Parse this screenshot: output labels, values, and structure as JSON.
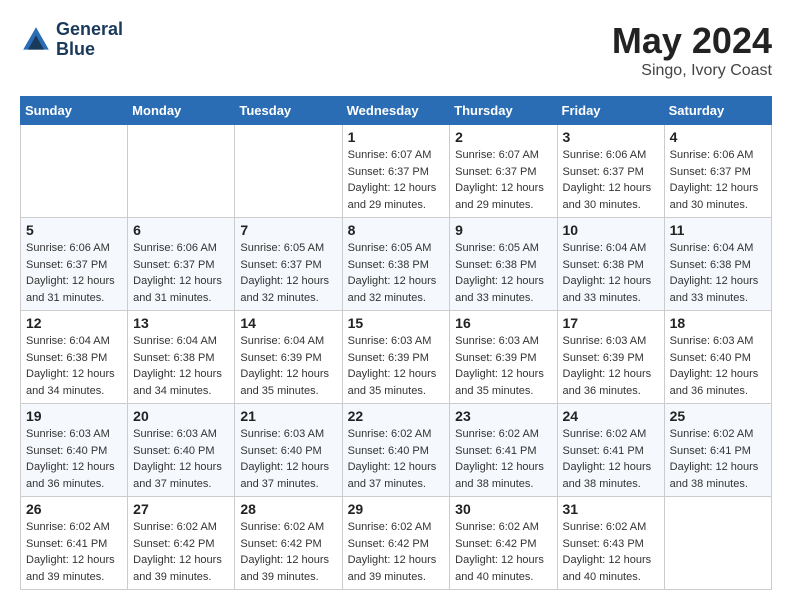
{
  "header": {
    "logo_line1": "General",
    "logo_line2": "Blue",
    "month_year": "May 2024",
    "location": "Singo, Ivory Coast"
  },
  "weekdays": [
    "Sunday",
    "Monday",
    "Tuesday",
    "Wednesday",
    "Thursday",
    "Friday",
    "Saturday"
  ],
  "weeks": [
    [
      {
        "day": "",
        "sunrise": "",
        "sunset": "",
        "daylight": ""
      },
      {
        "day": "",
        "sunrise": "",
        "sunset": "",
        "daylight": ""
      },
      {
        "day": "",
        "sunrise": "",
        "sunset": "",
        "daylight": ""
      },
      {
        "day": "1",
        "sunrise": "Sunrise: 6:07 AM",
        "sunset": "Sunset: 6:37 PM",
        "daylight": "Daylight: 12 hours and 29 minutes."
      },
      {
        "day": "2",
        "sunrise": "Sunrise: 6:07 AM",
        "sunset": "Sunset: 6:37 PM",
        "daylight": "Daylight: 12 hours and 29 minutes."
      },
      {
        "day": "3",
        "sunrise": "Sunrise: 6:06 AM",
        "sunset": "Sunset: 6:37 PM",
        "daylight": "Daylight: 12 hours and 30 minutes."
      },
      {
        "day": "4",
        "sunrise": "Sunrise: 6:06 AM",
        "sunset": "Sunset: 6:37 PM",
        "daylight": "Daylight: 12 hours and 30 minutes."
      }
    ],
    [
      {
        "day": "5",
        "sunrise": "Sunrise: 6:06 AM",
        "sunset": "Sunset: 6:37 PM",
        "daylight": "Daylight: 12 hours and 31 minutes."
      },
      {
        "day": "6",
        "sunrise": "Sunrise: 6:06 AM",
        "sunset": "Sunset: 6:37 PM",
        "daylight": "Daylight: 12 hours and 31 minutes."
      },
      {
        "day": "7",
        "sunrise": "Sunrise: 6:05 AM",
        "sunset": "Sunset: 6:37 PM",
        "daylight": "Daylight: 12 hours and 32 minutes."
      },
      {
        "day": "8",
        "sunrise": "Sunrise: 6:05 AM",
        "sunset": "Sunset: 6:38 PM",
        "daylight": "Daylight: 12 hours and 32 minutes."
      },
      {
        "day": "9",
        "sunrise": "Sunrise: 6:05 AM",
        "sunset": "Sunset: 6:38 PM",
        "daylight": "Daylight: 12 hours and 33 minutes."
      },
      {
        "day": "10",
        "sunrise": "Sunrise: 6:04 AM",
        "sunset": "Sunset: 6:38 PM",
        "daylight": "Daylight: 12 hours and 33 minutes."
      },
      {
        "day": "11",
        "sunrise": "Sunrise: 6:04 AM",
        "sunset": "Sunset: 6:38 PM",
        "daylight": "Daylight: 12 hours and 33 minutes."
      }
    ],
    [
      {
        "day": "12",
        "sunrise": "Sunrise: 6:04 AM",
        "sunset": "Sunset: 6:38 PM",
        "daylight": "Daylight: 12 hours and 34 minutes."
      },
      {
        "day": "13",
        "sunrise": "Sunrise: 6:04 AM",
        "sunset": "Sunset: 6:38 PM",
        "daylight": "Daylight: 12 hours and 34 minutes."
      },
      {
        "day": "14",
        "sunrise": "Sunrise: 6:04 AM",
        "sunset": "Sunset: 6:39 PM",
        "daylight": "Daylight: 12 hours and 35 minutes."
      },
      {
        "day": "15",
        "sunrise": "Sunrise: 6:03 AM",
        "sunset": "Sunset: 6:39 PM",
        "daylight": "Daylight: 12 hours and 35 minutes."
      },
      {
        "day": "16",
        "sunrise": "Sunrise: 6:03 AM",
        "sunset": "Sunset: 6:39 PM",
        "daylight": "Daylight: 12 hours and 35 minutes."
      },
      {
        "day": "17",
        "sunrise": "Sunrise: 6:03 AM",
        "sunset": "Sunset: 6:39 PM",
        "daylight": "Daylight: 12 hours and 36 minutes."
      },
      {
        "day": "18",
        "sunrise": "Sunrise: 6:03 AM",
        "sunset": "Sunset: 6:40 PM",
        "daylight": "Daylight: 12 hours and 36 minutes."
      }
    ],
    [
      {
        "day": "19",
        "sunrise": "Sunrise: 6:03 AM",
        "sunset": "Sunset: 6:40 PM",
        "daylight": "Daylight: 12 hours and 36 minutes."
      },
      {
        "day": "20",
        "sunrise": "Sunrise: 6:03 AM",
        "sunset": "Sunset: 6:40 PM",
        "daylight": "Daylight: 12 hours and 37 minutes."
      },
      {
        "day": "21",
        "sunrise": "Sunrise: 6:03 AM",
        "sunset": "Sunset: 6:40 PM",
        "daylight": "Daylight: 12 hours and 37 minutes."
      },
      {
        "day": "22",
        "sunrise": "Sunrise: 6:02 AM",
        "sunset": "Sunset: 6:40 PM",
        "daylight": "Daylight: 12 hours and 37 minutes."
      },
      {
        "day": "23",
        "sunrise": "Sunrise: 6:02 AM",
        "sunset": "Sunset: 6:41 PM",
        "daylight": "Daylight: 12 hours and 38 minutes."
      },
      {
        "day": "24",
        "sunrise": "Sunrise: 6:02 AM",
        "sunset": "Sunset: 6:41 PM",
        "daylight": "Daylight: 12 hours and 38 minutes."
      },
      {
        "day": "25",
        "sunrise": "Sunrise: 6:02 AM",
        "sunset": "Sunset: 6:41 PM",
        "daylight": "Daylight: 12 hours and 38 minutes."
      }
    ],
    [
      {
        "day": "26",
        "sunrise": "Sunrise: 6:02 AM",
        "sunset": "Sunset: 6:41 PM",
        "daylight": "Daylight: 12 hours and 39 minutes."
      },
      {
        "day": "27",
        "sunrise": "Sunrise: 6:02 AM",
        "sunset": "Sunset: 6:42 PM",
        "daylight": "Daylight: 12 hours and 39 minutes."
      },
      {
        "day": "28",
        "sunrise": "Sunrise: 6:02 AM",
        "sunset": "Sunset: 6:42 PM",
        "daylight": "Daylight: 12 hours and 39 minutes."
      },
      {
        "day": "29",
        "sunrise": "Sunrise: 6:02 AM",
        "sunset": "Sunset: 6:42 PM",
        "daylight": "Daylight: 12 hours and 39 minutes."
      },
      {
        "day": "30",
        "sunrise": "Sunrise: 6:02 AM",
        "sunset": "Sunset: 6:42 PM",
        "daylight": "Daylight: 12 hours and 40 minutes."
      },
      {
        "day": "31",
        "sunrise": "Sunrise: 6:02 AM",
        "sunset": "Sunset: 6:43 PM",
        "daylight": "Daylight: 12 hours and 40 minutes."
      },
      {
        "day": "",
        "sunrise": "",
        "sunset": "",
        "daylight": ""
      }
    ]
  ]
}
